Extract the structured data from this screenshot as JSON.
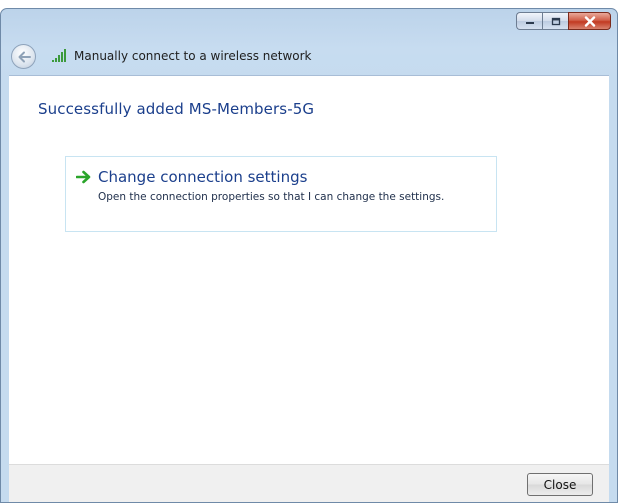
{
  "window": {
    "title": "Manually connect to a wireless network",
    "caption_icons": [
      "minimize-icon",
      "maximize-icon",
      "close-icon"
    ]
  },
  "nav": {
    "back_icon": "back-arrow-icon",
    "signal_icon": "wireless-signal-icon"
  },
  "content": {
    "heading": "Successfully added MS-Members-5G",
    "option": {
      "icon": "green-arrow-icon",
      "title": "Change connection settings",
      "description": "Open the connection properties so that I can change the settings."
    }
  },
  "footer": {
    "close_label": "Close"
  },
  "colors": {
    "heading": "#1b3f8c",
    "accent_green": "#2aa52a",
    "close_red": "#c23a22"
  }
}
